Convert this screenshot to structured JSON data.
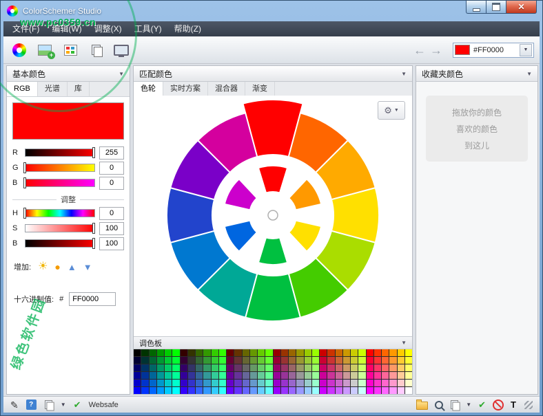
{
  "window": {
    "title": "ColorSchemer Studio"
  },
  "watermark": {
    "url": "www.pc0359.cn",
    "stamp": "绿色软件园"
  },
  "menubar": {
    "items": [
      "文件(F)",
      "编辑(W)",
      "调整(X)",
      "工具(Y)",
      "帮助(Z)"
    ]
  },
  "toolbar": {
    "nav_back": "←",
    "nav_forward": "→",
    "color_combo": {
      "hex": "#FF0000",
      "color": "#FF0000"
    },
    "dropdown_glyph": "▼"
  },
  "left_panel": {
    "header": "基本颜色",
    "tabs": [
      "RGB",
      "光谱",
      "库"
    ],
    "selected_tab": "RGB",
    "swatch_color": "#FF0000",
    "rgb_sliders": [
      {
        "label": "R",
        "value": "255",
        "percent": 100
      },
      {
        "label": "G",
        "value": "0",
        "percent": 0
      },
      {
        "label": "B",
        "value": "0",
        "percent": 0
      }
    ],
    "divider_label": "调整",
    "hsb_sliders": [
      {
        "label": "H",
        "value": "0",
        "percent": 0
      },
      {
        "label": "S",
        "value": "100",
        "percent": 100
      },
      {
        "label": "B",
        "value": "100",
        "percent": 100
      }
    ],
    "add_label": "增加:",
    "add_icons": {
      "lighten": "☀",
      "darken": "●",
      "up": "▲",
      "down": "▼"
    },
    "hex_label": "十六进制值:",
    "hex_prefix": "#",
    "hex_value": "FF0000"
  },
  "middle_panel": {
    "header": "匹配颜色",
    "tabs": [
      "色轮",
      "实时方案",
      "混合器",
      "渐变"
    ],
    "selected_tab": "色轮",
    "wheel": {
      "outer_colors": [
        "#FF0000",
        "#FF6600",
        "#FFAA00",
        "#FFE000",
        "#AADD00",
        "#44CC00",
        "#00C040",
        "#00A896",
        "#0078D0",
        "#2244CC",
        "#7A00C8",
        "#D4009E"
      ],
      "inner_colors": [
        "#FF0000",
        "#FF9900",
        "#FFE000",
        "#00C040",
        "#0066E0",
        "#CC00CC"
      ]
    },
    "gear_glyph": "⚙",
    "palette": {
      "header": "调色板",
      "scheme": "websafe",
      "cols": 36,
      "rows": 6,
      "step": 51
    }
  },
  "right_panel": {
    "header": "收藏夹颜色",
    "drop_lines": [
      "拖放你的颜色",
      "喜欢的颜色",
      "到这儿"
    ]
  },
  "statusbar": {
    "websafe_label": "Websafe"
  }
}
